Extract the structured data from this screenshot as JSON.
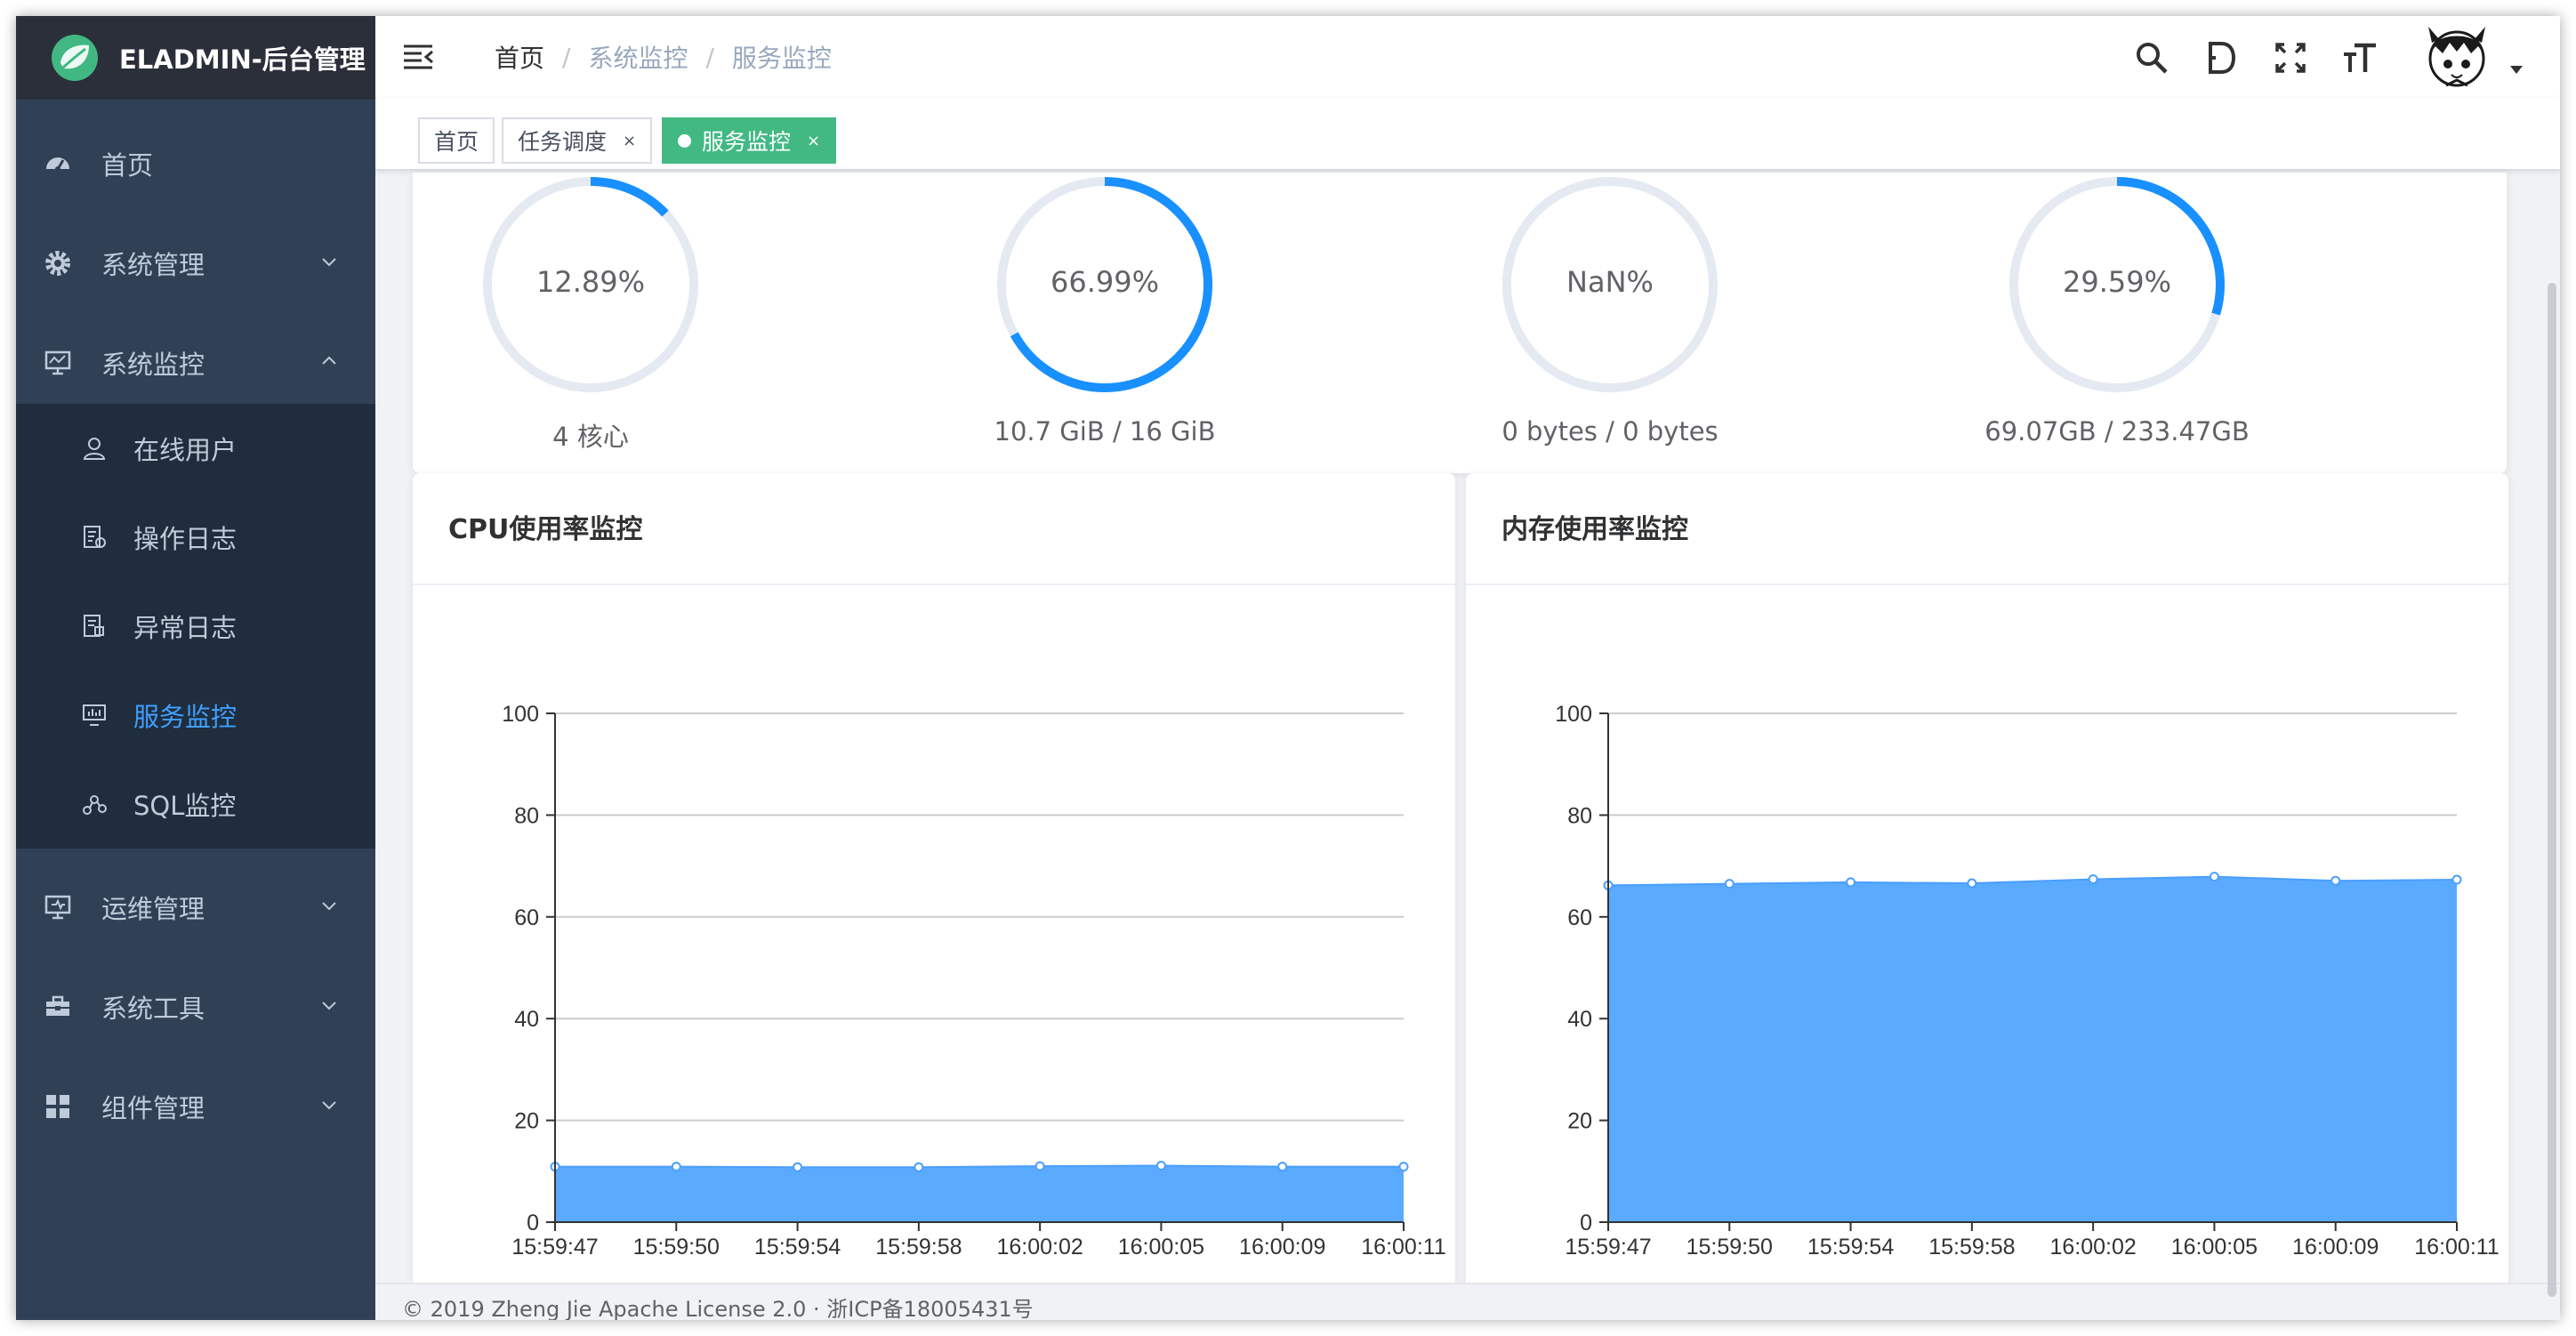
{
  "app": {
    "title": "ELADMIN-后台管理"
  },
  "colors": {
    "sidebar_bg": "#304156",
    "submenu_bg": "#1f2d3d",
    "accent": "#409eff",
    "tag_active": "#42b983",
    "area": "#5aaaff"
  },
  "sidebar": {
    "items": [
      {
        "label": "首页",
        "icon": "dashboard-icon"
      },
      {
        "label": "系统管理",
        "icon": "gear-icon"
      },
      {
        "label": "系统监控",
        "icon": "monitor-icon",
        "expanded": true
      },
      {
        "label": "运维管理",
        "icon": "server-icon"
      },
      {
        "label": "系统工具",
        "icon": "toolbox-icon"
      },
      {
        "label": "组件管理",
        "icon": "grid-icon"
      }
    ],
    "submenu": [
      {
        "label": "在线用户",
        "icon": "user-icon"
      },
      {
        "label": "操作日志",
        "icon": "log-icon"
      },
      {
        "label": "异常日志",
        "icon": "error-log-icon"
      },
      {
        "label": "服务监控",
        "icon": "server-monitor-icon",
        "active": true
      },
      {
        "label": "SQL监控",
        "icon": "sql-icon"
      }
    ]
  },
  "navbar": {
    "breadcrumb": [
      "首页",
      "系统监控",
      "服务监控"
    ],
    "tools": [
      "search-icon",
      "doc-icon",
      "fullscreen-icon",
      "font-size-icon"
    ]
  },
  "tags": [
    {
      "label": "首页"
    },
    {
      "label": "任务调度",
      "close": "×"
    },
    {
      "label": "服务监控",
      "close": "×",
      "active": true
    }
  ],
  "gauges": [
    {
      "value_text": "12.89%",
      "percent": 12.89,
      "caption": "4 核心"
    },
    {
      "value_text": "66.99%",
      "percent": 66.99,
      "caption": "10.7 GiB / 16 GiB"
    },
    {
      "value_text": "NaN%",
      "percent": 0,
      "caption": "0 bytes / 0 bytes"
    },
    {
      "value_text": "29.59%",
      "percent": 29.59,
      "caption": "69.07GB / 233.47GB"
    }
  ],
  "cards": {
    "cpu_title": "CPU使用率监控",
    "mem_title": "内存使用率监控"
  },
  "chart_data": [
    {
      "type": "area",
      "title": "CPU使用率监控",
      "x": [
        "15:59:47",
        "15:59:50",
        "15:59:54",
        "15:59:58",
        "16:00:02",
        "16:00:05",
        "16:00:09",
        "16:00:11"
      ],
      "values": [
        10.9,
        10.9,
        10.8,
        10.8,
        11.0,
        11.1,
        10.9,
        10.9
      ],
      "ylim": [
        0,
        100
      ],
      "yticks": [
        0,
        20,
        40,
        60,
        80,
        100
      ],
      "grid": true
    },
    {
      "type": "area",
      "title": "内存使用率监控",
      "x": [
        "15:59:47",
        "15:59:50",
        "15:59:54",
        "15:59:58",
        "16:00:02",
        "16:00:05",
        "16:00:09",
        "16:00:11"
      ],
      "values": [
        66.2,
        66.5,
        66.8,
        66.6,
        67.4,
        67.9,
        67.1,
        67.3
      ],
      "ylim": [
        0,
        100
      ],
      "yticks": [
        0,
        20,
        40,
        60,
        80,
        100
      ],
      "grid": true
    }
  ],
  "footer": {
    "text": "© 2019 Zheng Jie Apache License 2.0 · 浙ICP备18005431号"
  }
}
